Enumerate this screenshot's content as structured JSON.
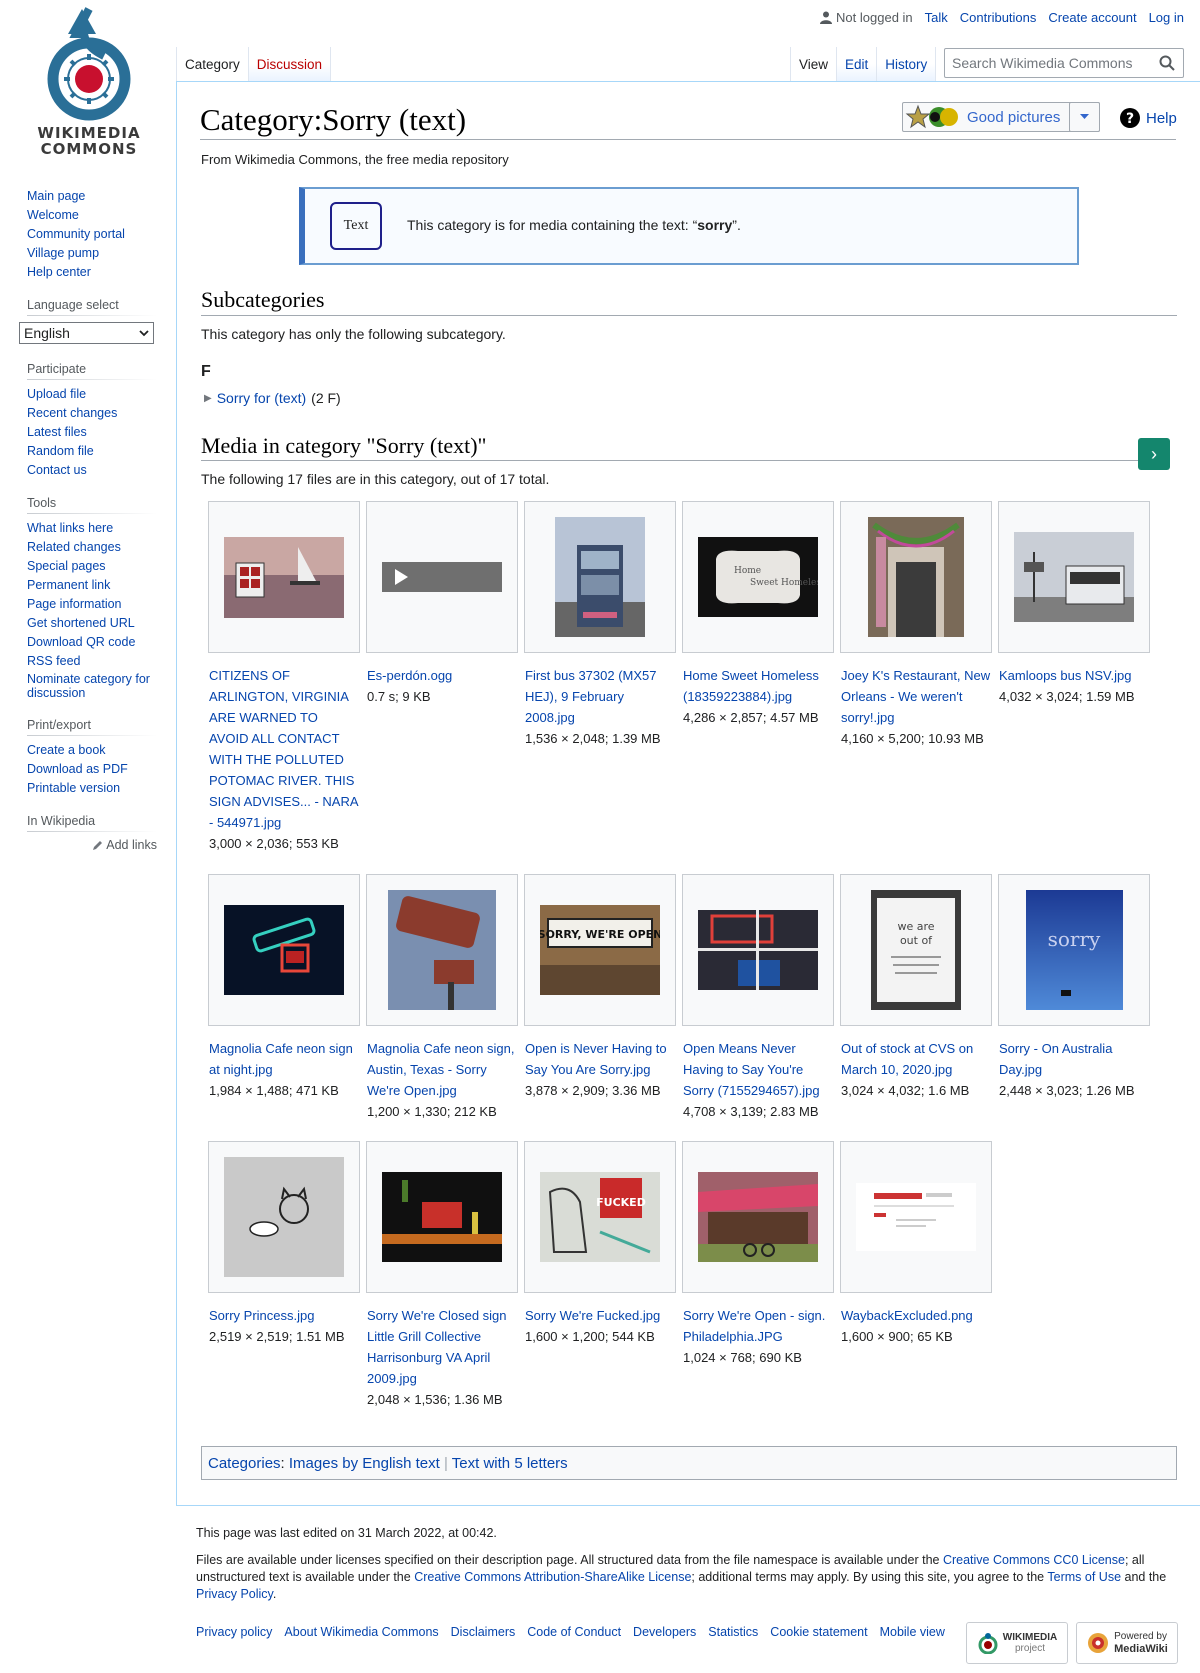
{
  "personal": {
    "not_logged_in": "Not logged in",
    "links": [
      "Talk",
      "Contributions",
      "Create account",
      "Log in"
    ]
  },
  "logo": {
    "line1": "WIKIMEDIA",
    "line2": "COMMONS"
  },
  "sidebar": {
    "navigation": [
      "Main page",
      "Welcome",
      "Community portal",
      "Village pump",
      "Help center"
    ],
    "language_heading": "Language select",
    "language_value": "English",
    "participate_heading": "Participate",
    "participate": [
      "Upload file",
      "Recent changes",
      "Latest files",
      "Random file",
      "Contact us"
    ],
    "tools_heading": "Tools",
    "tools": [
      "What links here",
      "Related changes",
      "Special pages",
      "Permanent link",
      "Page information",
      "Get shortened URL",
      "Download QR code",
      "RSS feed",
      "Nominate category for discussion"
    ],
    "print_heading": "Print/export",
    "print": [
      "Create a book",
      "Download as PDF",
      "Printable version"
    ],
    "wikipedia_heading": "In Wikipedia",
    "add_links": "Add links"
  },
  "tabs": {
    "left": [
      "Category",
      "Discussion"
    ],
    "right": [
      "View",
      "Edit",
      "History"
    ]
  },
  "search": {
    "placeholder": "Search Wikimedia Commons"
  },
  "page": {
    "title": "Category:Sorry (text)",
    "site_sub": "From Wikimedia Commons, the free media repository",
    "good_pictures": "Good pictures",
    "help": "Help"
  },
  "textbox": {
    "tag": "Text",
    "message_pre": "This category is for media containing the text: “",
    "message_bold": "sorry",
    "message_post": "”."
  },
  "subcategories": {
    "heading": "Subcategories",
    "intro": "This category has only the following subcategory.",
    "letter": "F",
    "item_link": "Sorry for (text)",
    "item_count": "(2 F)"
  },
  "media": {
    "heading": "Media in category \"Sorry (text)\"",
    "intro": "The following 17 files are in this category, out of 17 total.",
    "files": [
      {
        "name": "CITIZENS OF ARLINGTON, VIRGINIA ARE WARNED TO AVOID ALL CONTACT WITH THE POLLUTED POTOMAC RIVER. THIS SIGN ADVISES... - NARA - 544971.jpg",
        "meta": "3,000 × 2,036; 553 KB"
      },
      {
        "name": "Es-perdón.ogg",
        "meta": "0.7 s; 9 KB"
      },
      {
        "name": "First bus 37302 (MX57 HEJ), 9 February 2008.jpg",
        "meta": "1,536 × 2,048; 1.39 MB"
      },
      {
        "name": "Home Sweet Homeless (18359223884).jpg",
        "meta": "4,286 × 2,857; 4.57 MB"
      },
      {
        "name": "Joey K's Restaurant, New Orleans - We weren't sorry!.jpg",
        "meta": "4,160 × 5,200; 10.93 MB"
      },
      {
        "name": "Kamloops bus NSV.jpg",
        "meta": "4,032 × 3,024; 1.59 MB"
      },
      {
        "name": "Magnolia Cafe neon sign at night.jpg",
        "meta": "1,984 × 1,488; 471 KB"
      },
      {
        "name": "Magnolia Cafe neon sign, Austin, Texas - Sorry We're Open.jpg",
        "meta": "1,200 × 1,330; 212 KB"
      },
      {
        "name": "Open is Never Having to Say You Are Sorry.jpg",
        "meta": "3,878 × 2,909; 3.36 MB"
      },
      {
        "name": "Open Means Never Having to Say You're Sorry (7155294657).jpg",
        "meta": "4,708 × 3,139; 2.83 MB"
      },
      {
        "name": "Out of stock at CVS on March 10, 2020.jpg",
        "meta": "3,024 × 4,032; 1.6 MB"
      },
      {
        "name": "Sorry - On Australia Day.jpg",
        "meta": "2,448 × 3,023; 1.26 MB"
      },
      {
        "name": "Sorry Princess.jpg",
        "meta": "2,519 × 2,519; 1.51 MB"
      },
      {
        "name": "Sorry We're Closed sign Little Grill Collective Harrisonburg VA April 2009.jpg",
        "meta": "2,048 × 1,536; 1.36 MB"
      },
      {
        "name": "Sorry We're Fucked.jpg",
        "meta": "1,600 × 1,200; 544 KB"
      },
      {
        "name": "Sorry We're Open - sign. Philadelphia.JPG",
        "meta": "1,024 × 768; 690 KB"
      },
      {
        "name": "WaybackExcluded.png",
        "meta": "1,600 × 900; 65 KB"
      }
    ]
  },
  "catlinks": {
    "label": "Categories",
    "items": [
      "Images by English text",
      "Text with 5 letters"
    ]
  },
  "footer": {
    "last_edited": "This page was last edited on 31 March 2022, at 00:42.",
    "license_1": "Files are available under licenses specified on their description page. All structured data from the file namespace is available under the ",
    "license_link_1": "Creative Commons CC0 License",
    "license_2": "; all unstructured text is available under the ",
    "license_link_2": "Creative Commons Attribution-ShareAlike License",
    "license_3": "; additional terms may apply. By using this site, you agree to the ",
    "license_link_3": "Terms of Use",
    "license_4": " and the ",
    "license_link_4": "Privacy Policy",
    "license_5": ".",
    "links": [
      "Privacy policy",
      "About Wikimedia Commons",
      "Disclaimers",
      "Code of Conduct",
      "Developers",
      "Statistics",
      "Cookie statement",
      "Mobile view"
    ],
    "badge_wikimedia": "WIKIMEDIA",
    "badge_wikimedia_sub": "project",
    "badge_mw_1": "Powered by",
    "badge_mw_2": "MediaWiki"
  },
  "colors": {
    "link": "#0645ad",
    "new_link": "#ba0000",
    "media_button": "#14866d",
    "border": "#a2a9b1"
  }
}
